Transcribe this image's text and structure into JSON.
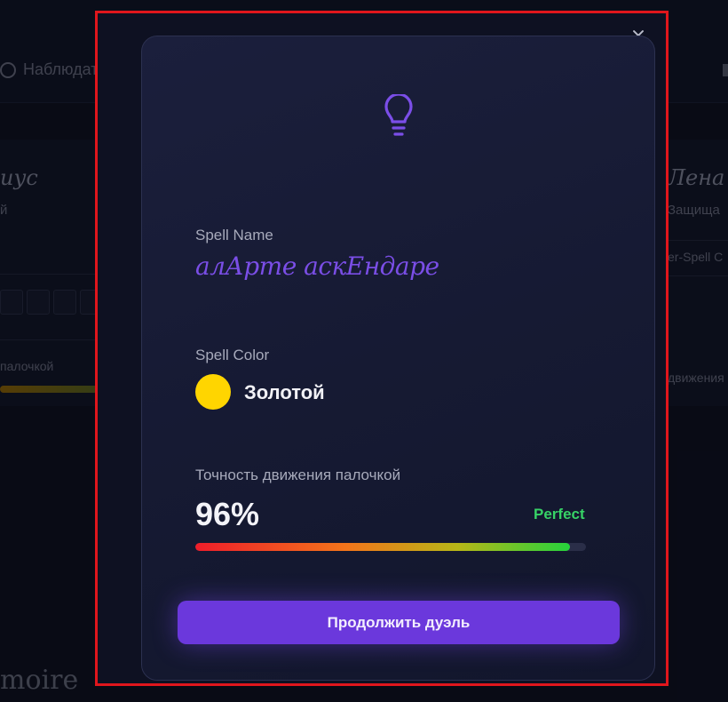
{
  "background": {
    "observe_label": "Наблюдать",
    "left_player": {
      "name": "иус",
      "subtitle": "й",
      "accuracy_label": "палочкой"
    },
    "right_player": {
      "name": "Лена",
      "subtitle": "Защища",
      "counter_label": "er-Spell C",
      "accuracy_label": "движения"
    },
    "footer_logo": "moire"
  },
  "modal": {
    "icon": "lightbulb-icon",
    "spell_name_label": "Spell Name",
    "spell_name_value": "алАрте аскЕндаре",
    "spell_color_label": "Spell Color",
    "spell_color_name": "Золотой",
    "spell_color_hex": "#ffd500",
    "accuracy_label": "Точность движения палочкой",
    "accuracy_value": "96%",
    "accuracy_percent": 96,
    "accuracy_rating": "Perfect",
    "continue_label": "Продолжить дуэль"
  },
  "colors": {
    "accent": "#6b38dc",
    "highlight_border": "#e0161c",
    "rating_green": "#37d266"
  }
}
